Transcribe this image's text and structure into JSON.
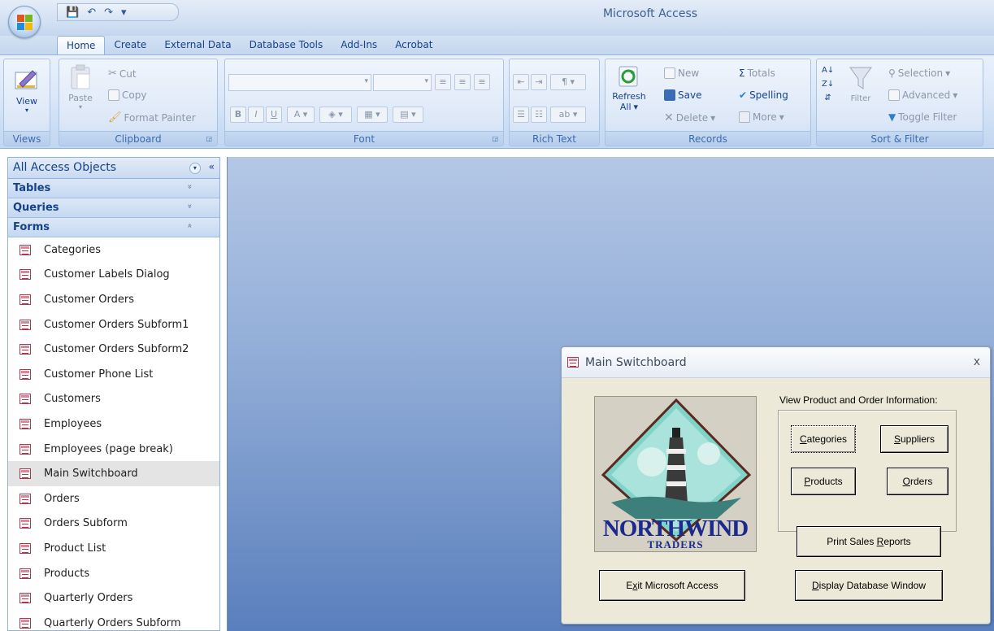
{
  "app": {
    "title": "Microsoft Access"
  },
  "quick_access": {
    "save": "💾",
    "undo": "↶",
    "redo": "↷",
    "customize": "▾"
  },
  "tabs": [
    "Home",
    "Create",
    "External Data",
    "Database Tools",
    "Add-Ins",
    "Acrobat"
  ],
  "ribbon": {
    "views": {
      "view": "View",
      "label": "Views"
    },
    "clipboard": {
      "paste": "Paste",
      "cut": "Cut",
      "copy": "Copy",
      "format_painter": "Format Painter",
      "label": "Clipboard"
    },
    "font": {
      "label": "Font",
      "bold": "B",
      "italic": "I",
      "underline": "U"
    },
    "rich_text": {
      "label": "Rich Text"
    },
    "records": {
      "refresh": "Refresh",
      "refresh_all": "All",
      "new": "New",
      "save": "Save",
      "delete": "Delete",
      "totals": "Totals",
      "spelling": "Spelling",
      "more": "More",
      "label": "Records"
    },
    "sort_filter": {
      "filter": "Filter",
      "selection": "Selection",
      "advanced": "Advanced",
      "toggle_filter": "Toggle Filter",
      "label": "Sort & Filter"
    }
  },
  "nav": {
    "header": "All Access Objects",
    "categories": [
      {
        "name": "Tables",
        "chev": "»"
      },
      {
        "name": "Queries",
        "chev": "»"
      },
      {
        "name": "Forms",
        "chev": "«"
      }
    ],
    "forms": [
      "Categories",
      "Customer Labels Dialog",
      "Customer Orders",
      "Customer Orders Subform1",
      "Customer Orders Subform2",
      "Customer Phone List",
      "Customers",
      "Employees",
      "Employees (page break)",
      "Main Switchboard",
      "Orders",
      "Orders Subform",
      "Product List",
      "Products",
      "Quarterly Orders",
      "Quarterly Orders Subform"
    ],
    "selected": "Main Switchboard"
  },
  "switchboard": {
    "title": "Main Switchboard",
    "close": "x",
    "logo_line1": "NORTHWIND",
    "logo_line2": "TRADERS",
    "info": "View Product and Order Information:",
    "buttons": {
      "categories": {
        "u": "C",
        "rest": "ategories"
      },
      "suppliers": {
        "u": "S",
        "rest": "uppliers"
      },
      "products": {
        "u": "P",
        "rest": "roducts"
      },
      "orders": {
        "u": "O",
        "rest": "rders"
      },
      "print_pre": "Print Sales ",
      "print_u": "R",
      "print_rest": "eports",
      "exit_pre": "E",
      "exit_u": "x",
      "exit_rest": "it Microsoft Access",
      "display_u": "D",
      "display_rest": "isplay Database Window"
    }
  }
}
